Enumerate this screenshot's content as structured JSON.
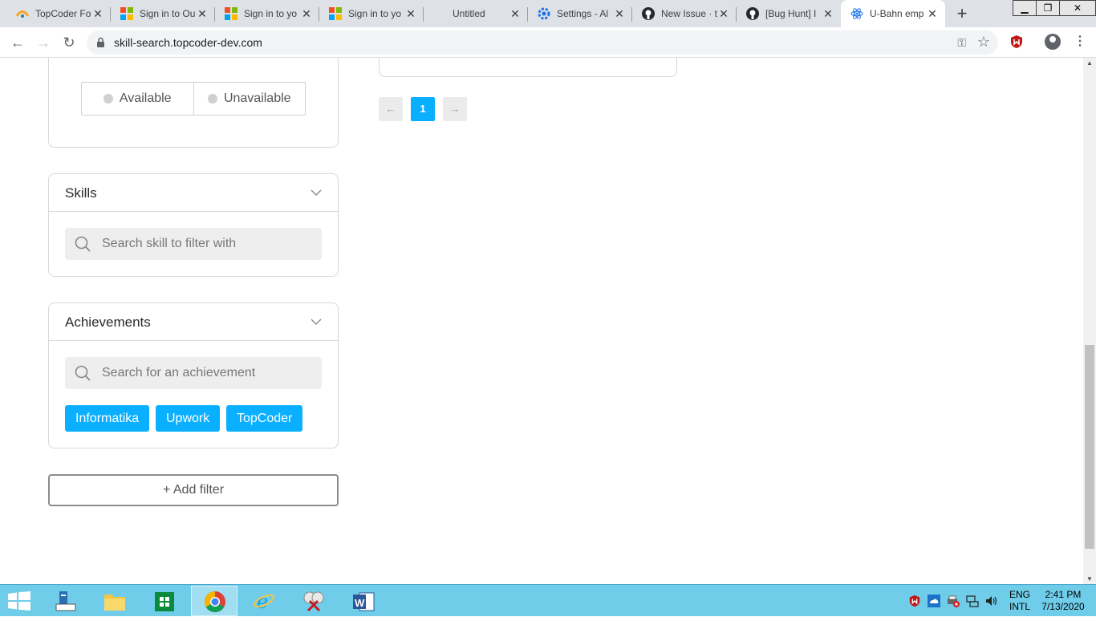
{
  "browser": {
    "tabs": [
      {
        "label": "TopCoder Fo",
        "icon": "topcoder-favicon"
      },
      {
        "label": "Sign in to Ou",
        "icon": "microsoft-favicon"
      },
      {
        "label": "Sign in to yo",
        "icon": "microsoft-favicon"
      },
      {
        "label": "Sign in to yo",
        "icon": "microsoft-favicon"
      },
      {
        "label": "Untitled",
        "icon": "none"
      },
      {
        "label": "Settings - Al",
        "icon": "gear-favicon"
      },
      {
        "label": "New Issue · t",
        "icon": "github-favicon"
      },
      {
        "label": "[Bug Hunt] I",
        "icon": "github-favicon"
      },
      {
        "label": "U-Bahn emp",
        "icon": "react-favicon"
      }
    ],
    "url": "skill-search.topcoder-dev.com"
  },
  "availability": {
    "options": [
      "Available",
      "Unavailable"
    ]
  },
  "skills": {
    "title": "Skills",
    "search_placeholder": "Search skill to filter with"
  },
  "achievements": {
    "title": "Achievements",
    "search_placeholder": "Search for an achievement",
    "chips": [
      "Informatika",
      "Upwork",
      "TopCoder"
    ]
  },
  "add_filter_label": "+ Add filter",
  "pagination": {
    "prev": "←",
    "current": "1",
    "next": "→"
  },
  "taskbar": {
    "apps": [
      "file-explorer-icon",
      "folder-icon",
      "store-icon",
      "chrome-icon",
      "internet-explorer-icon",
      "snipping-tool-icon",
      "word-icon"
    ],
    "lang_top": "ENG",
    "lang_bottom": "INTL",
    "time": "2:41 PM",
    "date": "7/13/2020"
  },
  "colors": {
    "accent": "#0ab0ff",
    "taskbar": "#6fcdea"
  }
}
